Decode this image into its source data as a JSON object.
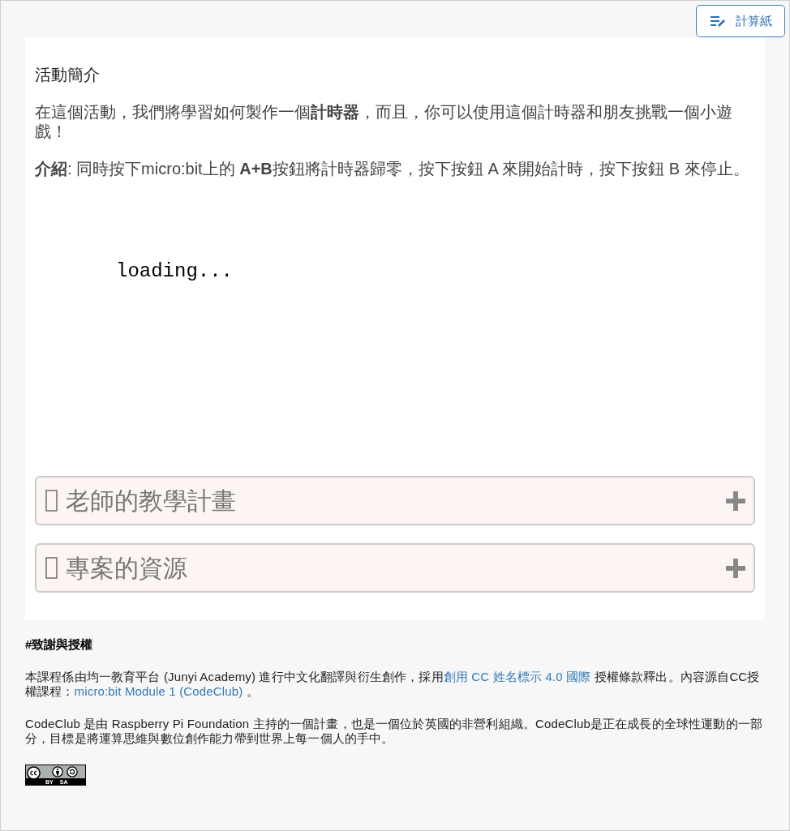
{
  "toolbar": {
    "scratchpad_button": {
      "label": "計算紙"
    }
  },
  "activity": {
    "heading": "活動簡介",
    "paragraphs": [
      "在這個活動，我們將學習如何製作一個**計時器**，而且，你可以使用這個計時器和朋友挑戰一個小遊戲！",
      "**介紹**: 同時按下micro:bit上的 **A+B**按鈕將計時器歸零，按下按鈕 A 來開始計時，按下按鈕 B 來停止。"
    ],
    "embed": {
      "status": "loading..."
    }
  },
  "accordions": [
    {
      "title": "老師的教學計畫",
      "expanded": false
    },
    {
      "title": "專案的資源",
      "expanded": false
    }
  ],
  "credits": {
    "heading": "#致謝與授權",
    "paragraphs": [
      [
        {
          "kind": "text",
          "text": "本課程係由均一教育平台 (Junyi Academy) 進行中文化翻譯與衍生創作，採用"
        },
        {
          "kind": "link",
          "text": "創用 CC 姓名標示 4.0 國際"
        },
        {
          "kind": "text",
          "text": " 授權條款釋出。內容源自CC授權課程："
        },
        {
          "kind": "link",
          "text": "micro:bit Module 1 (CodeClub)"
        },
        {
          "kind": "text",
          "text": " 。"
        }
      ],
      [
        {
          "kind": "text",
          "text": "CodeClub 是由 Raspberry Pi Foundation 主持的一個計畫，也是一個位於英國的非營利組織。CodeClub是正在成長的全球性運動的一部分，目標是將運算思維與數位創作能力帶到世界上每一個人的手中。"
        }
      ]
    ]
  },
  "license_badge": {
    "labels": [
      "BY",
      "SA"
    ]
  }
}
